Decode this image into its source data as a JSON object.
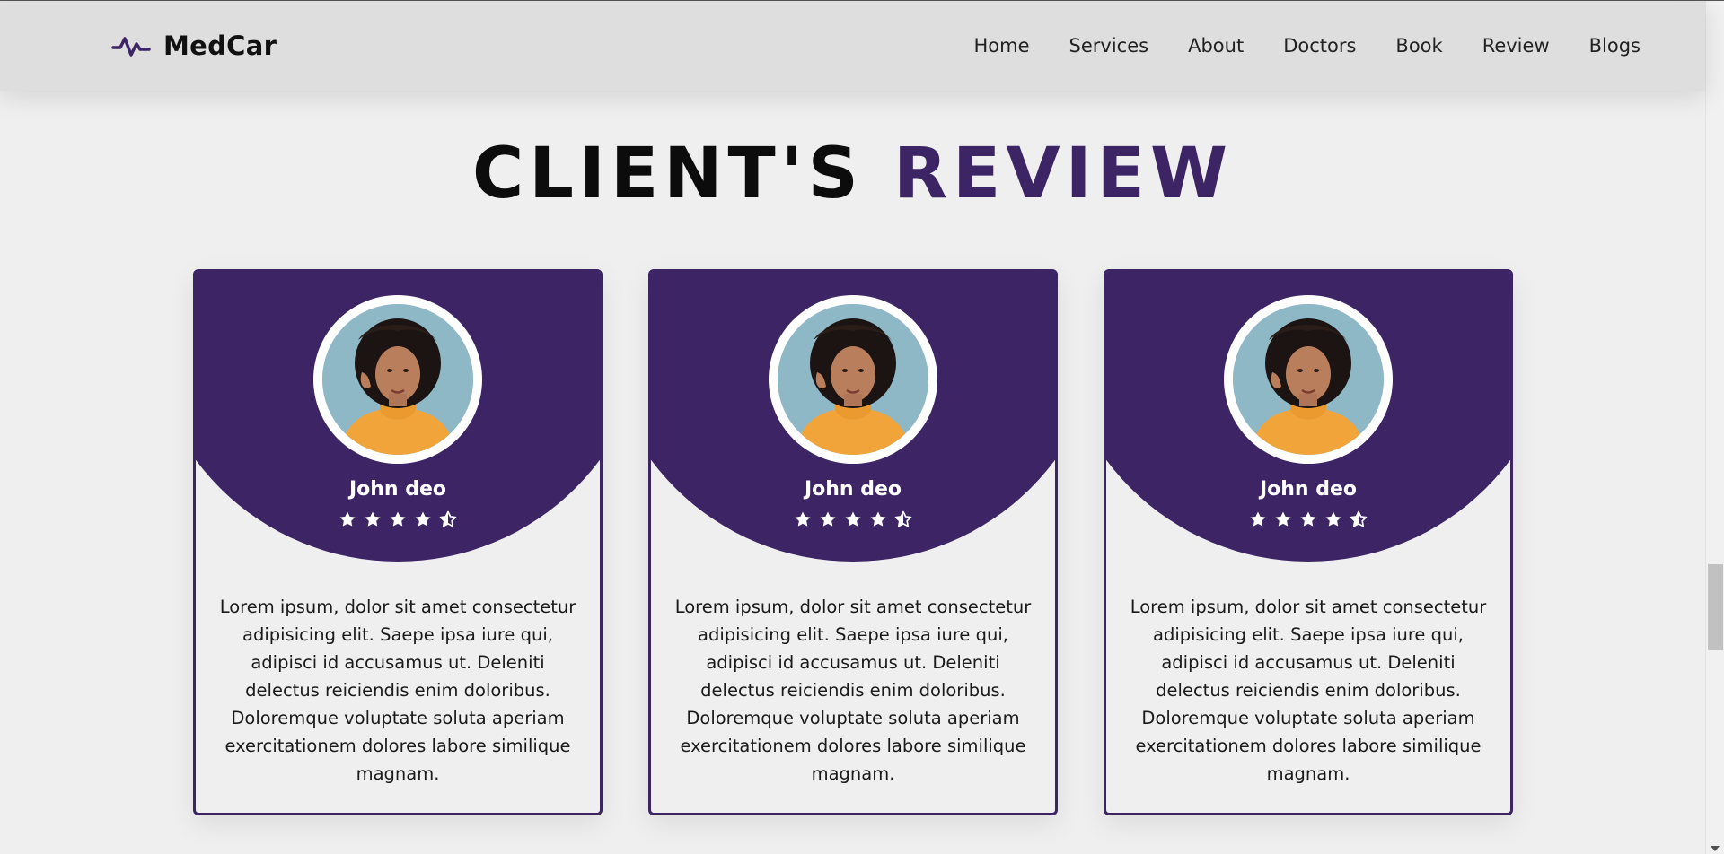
{
  "brand": {
    "name": "MedCar",
    "icon": "pulse-icon",
    "accent_color": "#3c2465"
  },
  "nav": {
    "items": [
      {
        "label": "Home"
      },
      {
        "label": "Services"
      },
      {
        "label": "About"
      },
      {
        "label": "Doctors"
      },
      {
        "label": "Book"
      },
      {
        "label": "Review"
      },
      {
        "label": "Blogs"
      }
    ]
  },
  "section": {
    "title_main": "CLIENT'S",
    "title_accent": "REVIEW"
  },
  "reviews": [
    {
      "name": "John deo",
      "rating": 4.5,
      "text": "Lorem ipsum, dolor sit amet consectetur adipisicing elit. Saepe ipsa iure qui, adipisci id accusamus ut. Deleniti delectus reiciendis enim doloribus. Doloremque voluptate soluta aperiam exercitationem dolores labore similique magnam."
    },
    {
      "name": "John deo",
      "rating": 4.5,
      "text": "Lorem ipsum, dolor sit amet consectetur adipisicing elit. Saepe ipsa iure qui, adipisci id accusamus ut. Deleniti delectus reiciendis enim doloribus. Doloremque voluptate soluta aperiam exercitationem dolores labore similique magnam."
    },
    {
      "name": "John deo",
      "rating": 4.5,
      "text": "Lorem ipsum, dolor sit amet consectetur adipisicing elit. Saepe ipsa iure qui, adipisci id accusamus ut. Deleniti delectus reiciendis enim doloribus. Doloremque voluptate soluta aperiam exercitationem dolores labore similique magnam."
    }
  ]
}
